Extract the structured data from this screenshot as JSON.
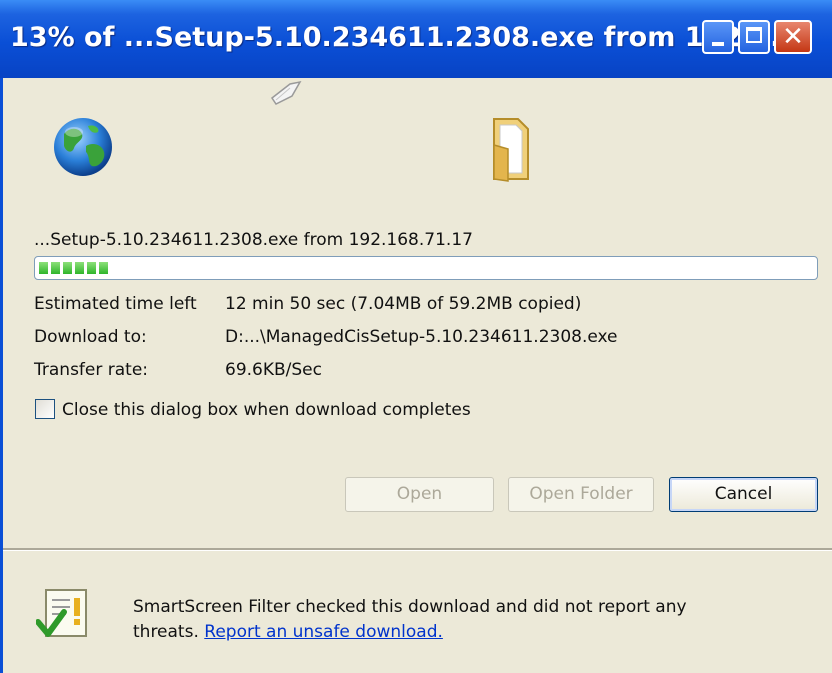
{
  "window": {
    "title": "13% of ...Setup-5.10.234611.2308.exe from 192.1...",
    "controls": {
      "minimize": "minimize",
      "maximize": "maximize",
      "close": "✕"
    }
  },
  "icons": [
    "globe-icon",
    "folder-icon",
    "flying-paper-icon",
    "smartscreen-shield-icon"
  ],
  "download": {
    "source": "...Setup-5.10.234611.2308.exe from 192.168.71.17",
    "progress_percent": 13,
    "progress_segments": 6,
    "estimated_label": "Estimated time left",
    "estimated_value": "12 min 50 sec (7.04MB of 59.2MB copied)",
    "download_to_label": "Download to:",
    "download_to_value": "D:...\\ManagedCisSetup-5.10.234611.2308.exe",
    "transfer_rate_label": "Transfer rate:",
    "transfer_rate_value": "69.6KB/Sec"
  },
  "close_on_complete": {
    "label": "Close this dialog box when download completes",
    "checked": false
  },
  "buttons": {
    "open": "Open",
    "open_folder": "Open Folder",
    "cancel": "Cancel"
  },
  "smartscreen": {
    "line1": "SmartScreen Filter checked this download and did not report any",
    "line2_prefix": "threats.",
    "link": "Report an unsafe download."
  },
  "colors": {
    "titlebar": "#0a4fd6",
    "dialog_bg": "#ece9d8",
    "progress": "#2fb52a",
    "link": "#0033cc"
  }
}
